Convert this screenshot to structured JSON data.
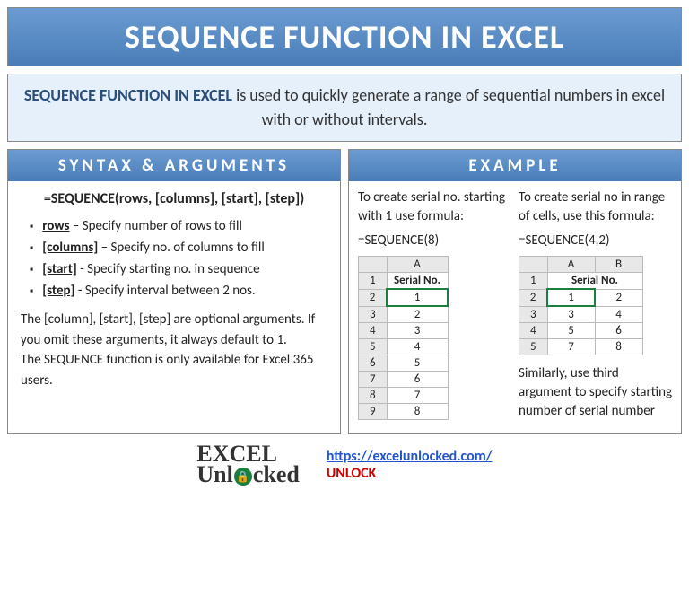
{
  "main_title": "SEQUENCE FUNCTION IN EXCEL",
  "intro": {
    "bold": "SEQUENCE FUNCTION IN EXCEL",
    "text": " is used to quickly generate a range of sequential numbers in excel with or without intervals."
  },
  "syntax": {
    "header": "SYNTAX & ARGUMENTS",
    "formula": "=SEQUENCE(rows, [columns], [start], [step])",
    "args": [
      {
        "name": "rows",
        "desc": " – Specify number of rows to fill"
      },
      {
        "name": "[columns]",
        "desc": " – Specify no. of columns to fill"
      },
      {
        "name": "[start]",
        "desc": " - Specify starting no. in sequence"
      },
      {
        "name": "[step]",
        "desc": " - Specify interval between 2  nos."
      }
    ],
    "note1": "The [column], [start], [step] are optional arguments. If you omit these arguments, it always default to 1.",
    "note2": "The SEQUENCE function is only available for Excel 365 users."
  },
  "example": {
    "header": "EXAMPLE",
    "left": {
      "text": "To create serial no. starting with 1 use formula:",
      "formula": "=SEQUENCE(8)",
      "table": {
        "col_header": "A",
        "serial_header": "Serial No.",
        "rows": [
          {
            "r": "1"
          },
          {
            "r": "2",
            "v": "1"
          },
          {
            "r": "3",
            "v": "2"
          },
          {
            "r": "4",
            "v": "3"
          },
          {
            "r": "5",
            "v": "4"
          },
          {
            "r": "6",
            "v": "5"
          },
          {
            "r": "7",
            "v": "6"
          },
          {
            "r": "8",
            "v": "7"
          },
          {
            "r": "9",
            "v": "8"
          }
        ]
      }
    },
    "right": {
      "text": "To create serial no in range of cells, use this formula:",
      "formula": "=SEQUENCE(4,2)",
      "table": {
        "col_a": "A",
        "col_b": "B",
        "serial_header": "Serial No.",
        "rows": [
          {
            "r": "2",
            "a": "1",
            "b": "2"
          },
          {
            "r": "3",
            "a": "3",
            "b": "4"
          },
          {
            "r": "4",
            "a": "5",
            "b": "6"
          },
          {
            "r": "5",
            "a": "7",
            "b": "8"
          }
        ]
      },
      "below_text": "Similarly, use third argument to specify starting number of serial number"
    }
  },
  "footer": {
    "logo_line1": "EXCEL",
    "logo_line2_pre": "Unl",
    "logo_line2_post": "cked",
    "url": "https://excelunlocked.com/",
    "unlock": "UNLOCK"
  }
}
